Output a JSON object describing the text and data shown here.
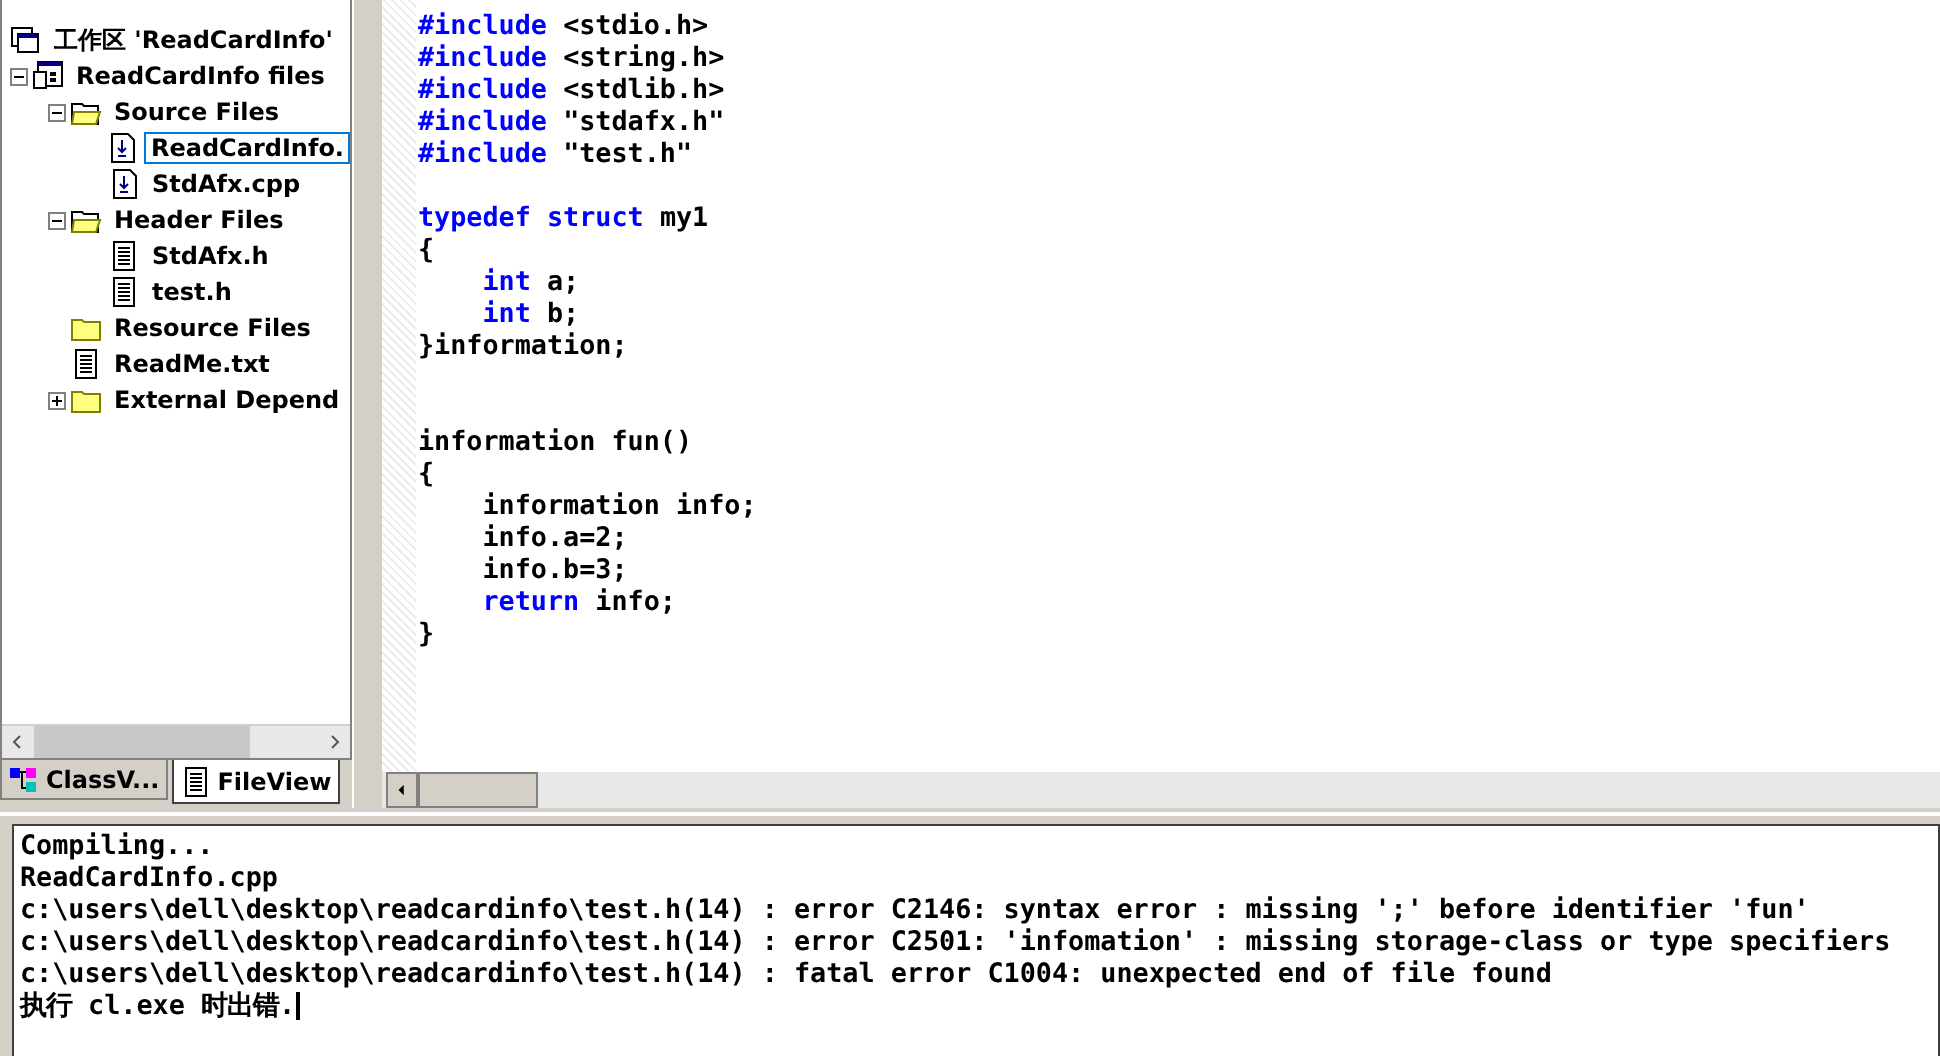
{
  "workspace_tree": [
    {
      "label": "工作区 'ReadCardInfo'",
      "kind": "workspace",
      "selected": false,
      "children": [
        {
          "label": "ReadCardInfo files",
          "kind": "project",
          "selected": false,
          "expanded": true,
          "children": [
            {
              "label": "Source Files",
              "kind": "folder-open",
              "selected": false,
              "expanded": true,
              "children": [
                {
                  "label": "ReadCardInfo.",
                  "kind": "source",
                  "selected": true
                },
                {
                  "label": "StdAfx.cpp",
                  "kind": "source",
                  "selected": false
                }
              ]
            },
            {
              "label": "Header Files",
              "kind": "folder-open",
              "selected": false,
              "expanded": true,
              "children": [
                {
                  "label": "StdAfx.h",
                  "kind": "text",
                  "selected": false
                },
                {
                  "label": "test.h",
                  "kind": "text",
                  "selected": false
                }
              ]
            },
            {
              "label": "Resource Files",
              "kind": "folder",
              "selected": false
            },
            {
              "label": "ReadMe.txt",
              "kind": "text",
              "selected": false
            },
            {
              "label": "External Depend",
              "kind": "folder",
              "selected": false,
              "expanded": false
            }
          ]
        }
      ]
    }
  ],
  "panel_tabs": [
    {
      "label": "ClassV...",
      "kind": "class",
      "selected": false
    },
    {
      "label": "FileView",
      "kind": "text",
      "selected": true
    }
  ],
  "code_lines": [
    {
      "indented": false,
      "tokens": [
        {
          "kind": "keyword",
          "text": "#include"
        },
        {
          "kind": "plain",
          "text": "<stdio.h>"
        }
      ]
    },
    {
      "indented": false,
      "tokens": [
        {
          "kind": "keyword",
          "text": "#include"
        },
        {
          "kind": "plain",
          "text": "<string.h>"
        }
      ]
    },
    {
      "indented": false,
      "tokens": [
        {
          "kind": "keyword",
          "text": "#include"
        },
        {
          "kind": "plain",
          "text": "<stdlib.h>"
        }
      ]
    },
    {
      "indented": false,
      "tokens": [
        {
          "kind": "keyword",
          "text": "#include"
        },
        {
          "kind": "plain",
          "text": "\"stdafx.h\""
        }
      ]
    },
    {
      "indented": false,
      "tokens": [
        {
          "kind": "keyword",
          "text": "#include"
        },
        {
          "kind": "plain",
          "text": "\"test.h\""
        }
      ]
    },
    {
      "kind": "blank"
    },
    {
      "indented": false,
      "tokens": [
        {
          "kind": "keyword",
          "text": "typedef"
        },
        {
          "kind": "keyword",
          "text": "struct"
        },
        {
          "kind": "plain",
          "text": "my1"
        }
      ]
    },
    {
      "indented": false,
      "tokens": [
        {
          "kind": "plain",
          "text": "{"
        }
      ]
    },
    {
      "indented": true,
      "tokens": [
        {
          "kind": "keyword",
          "text": "int"
        },
        {
          "kind": "plain",
          "text": "a;"
        }
      ]
    },
    {
      "indented": true,
      "tokens": [
        {
          "kind": "keyword",
          "text": "int"
        },
        {
          "kind": "plain",
          "text": "b;"
        }
      ]
    },
    {
      "indented": false,
      "tokens": [
        {
          "kind": "plain",
          "text": "}information;"
        }
      ]
    },
    {
      "kind": "blank"
    },
    {
      "kind": "blank"
    },
    {
      "indented": false,
      "tokens": [
        {
          "kind": "plain",
          "text": "information fun()"
        }
      ]
    },
    {
      "indented": false,
      "tokens": [
        {
          "kind": "plain",
          "text": "{"
        }
      ]
    },
    {
      "indented": true,
      "tokens": [
        {
          "kind": "plain",
          "text": "information info;"
        }
      ]
    },
    {
      "indented": true,
      "tokens": [
        {
          "kind": "plain",
          "text": "info.a=2;"
        }
      ]
    },
    {
      "indented": true,
      "tokens": [
        {
          "kind": "plain",
          "text": "info.b=3;"
        }
      ]
    },
    {
      "indented": true,
      "tokens": [
        {
          "kind": "keyword",
          "text": "return"
        },
        {
          "kind": "plain",
          "text": "info;"
        }
      ]
    },
    {
      "indented": false,
      "tokens": [
        {
          "kind": "plain",
          "text": "}"
        }
      ]
    }
  ],
  "output_lines": [
    "Compiling...",
    "ReadCardInfo.cpp",
    "c:\\users\\dell\\desktop\\readcardinfo\\test.h(14) : error C2146: syntax error : missing ';' before identifier 'fun'",
    "c:\\users\\dell\\desktop\\readcardinfo\\test.h(14) : error C2501: 'infomation' : missing storage-class or type specifiers",
    "c:\\users\\dell\\desktop\\readcardinfo\\test.h(14) : fatal error C1004: unexpected end of file found",
    "执行 cl.exe 时出错."
  ]
}
